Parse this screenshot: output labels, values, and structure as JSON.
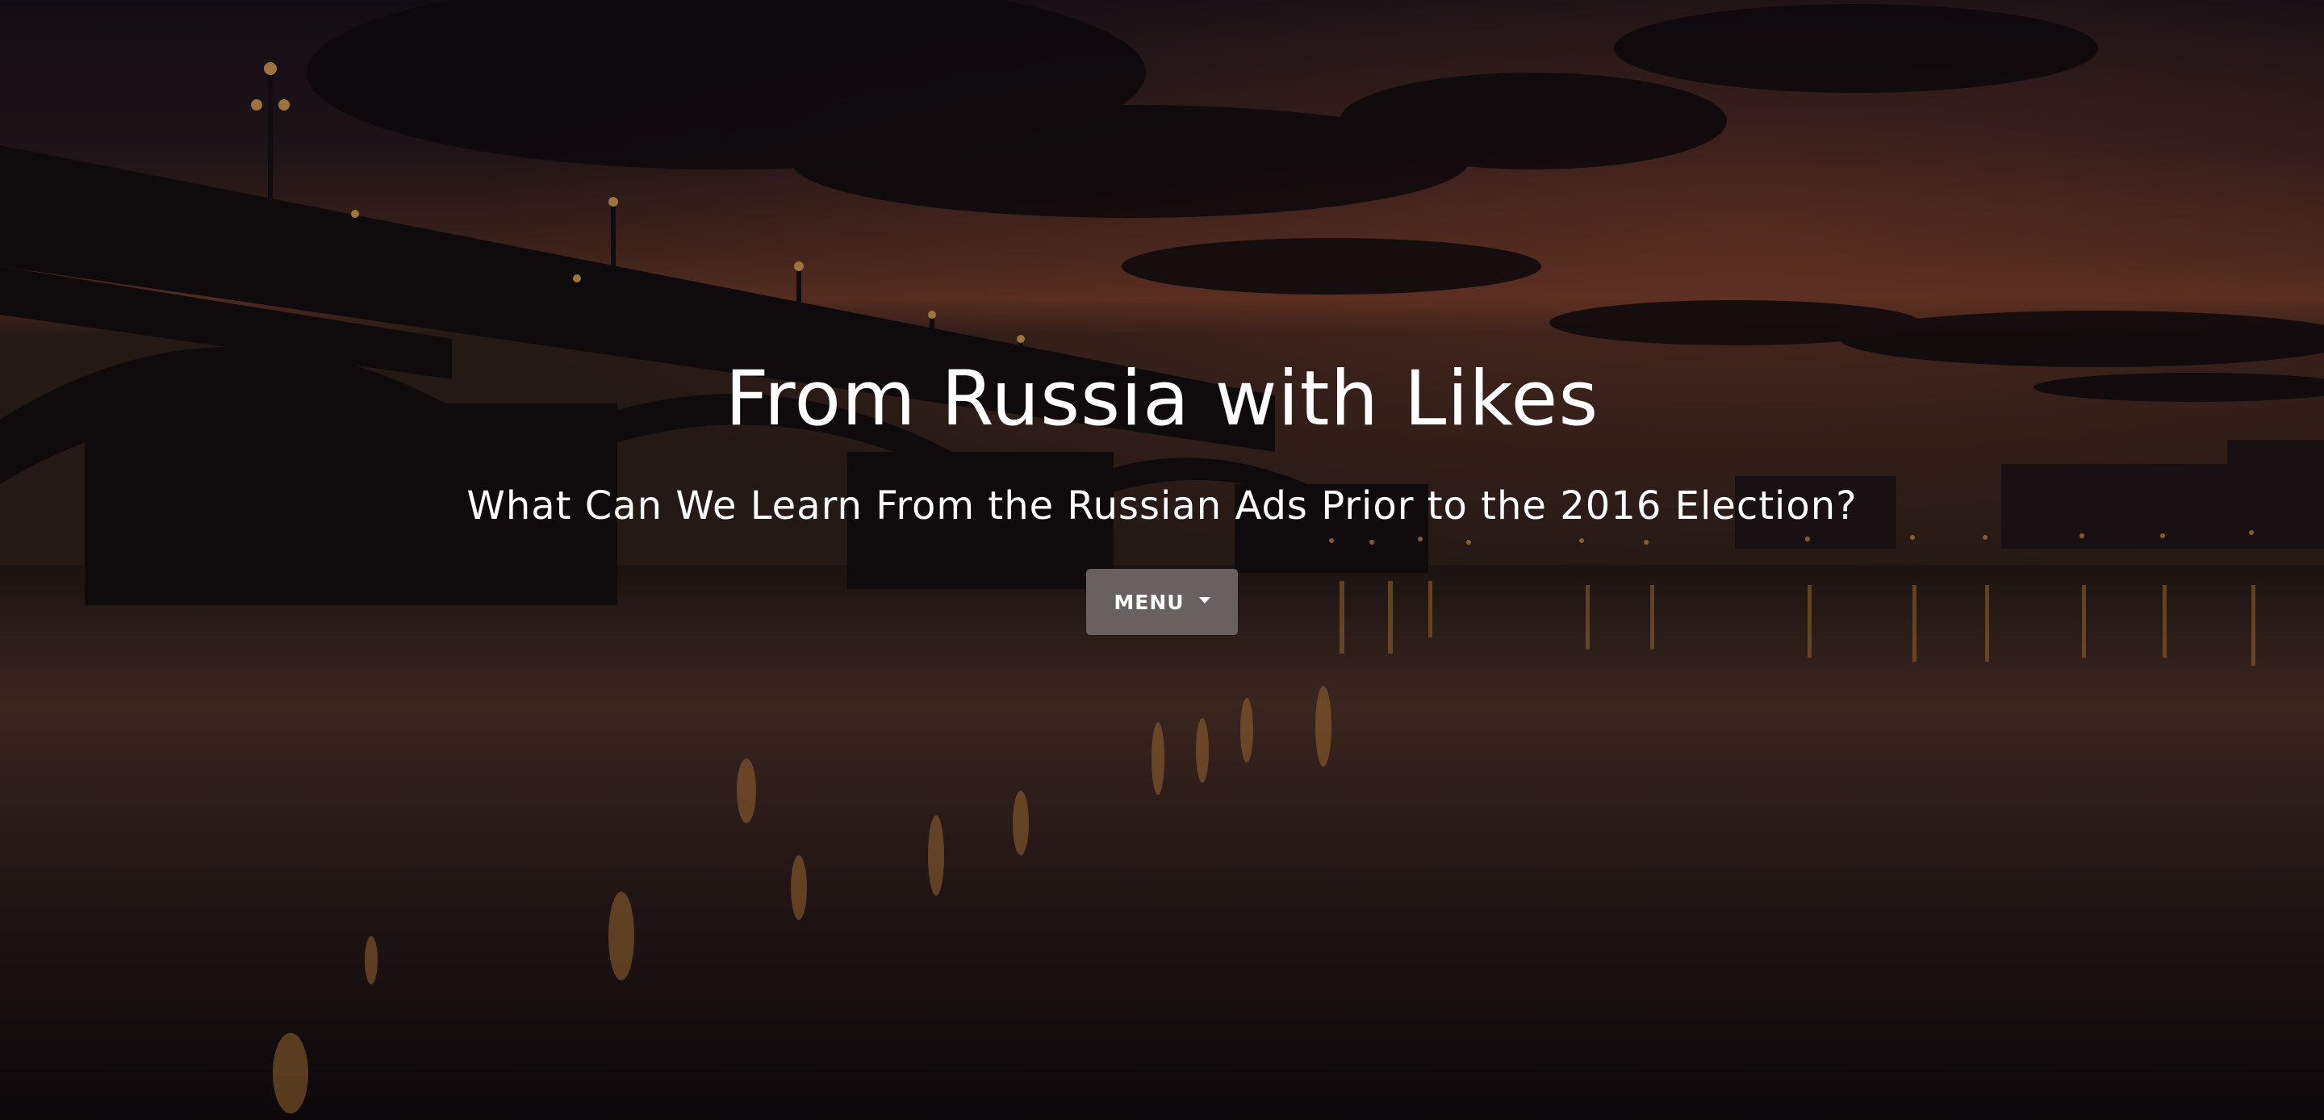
{
  "hero": {
    "title": "From Russia with Likes",
    "subtitle": "What Can We Learn From the Russian Ads Prior to the 2016 Election?",
    "background_image": "night-bridge-river-reflection"
  },
  "menu": {
    "label": "MENU",
    "icon": "caret-down-icon"
  },
  "colors": {
    "overlay": "#000000",
    "button_bg": "#68615f",
    "text": "#ffffff",
    "sky_glow": "#b45a3a",
    "lamp_light": "#f3a24a"
  }
}
